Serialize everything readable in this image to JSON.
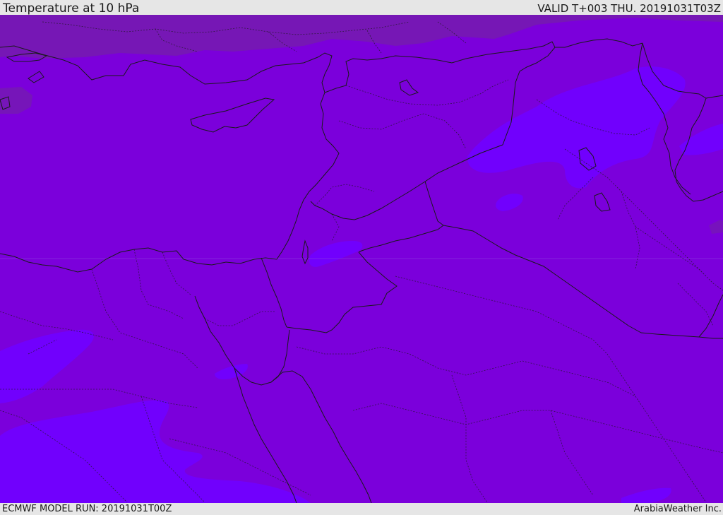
{
  "header": {
    "title": "Temperature at 10 hPa",
    "valid_time": "VALID T+003 THU. 20191031T03Z"
  },
  "footer": {
    "model_run": "ECMWF MODEL RUN: 20191031T00Z",
    "credit": "ArabiaWeather Inc."
  },
  "map": {
    "colors": {
      "base": "#7b00db",
      "cooler": "#761ab0",
      "warmer": "#7100ff",
      "border": "#1a1a1a"
    }
  }
}
